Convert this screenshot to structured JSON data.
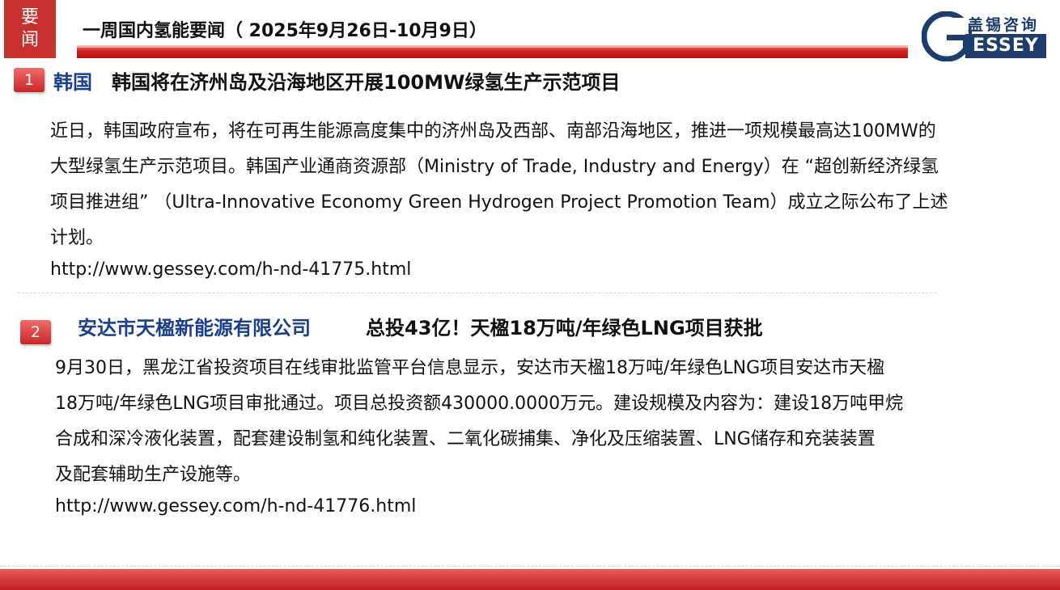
{
  "header": {
    "tag_char_1": "要",
    "tag_char_2": "闻",
    "title": "一周国内氢能要闻（ 2025年9月26日-10月9日）",
    "logo_chinese": "盖锡咨询",
    "logo_latin": "ESSEY",
    "logo_initial": "G"
  },
  "items": [
    {
      "number": "1",
      "org": "韩国",
      "headline": "韩国将在济州岛及沿海地区开展100MW绿氢生产示范项目",
      "lines": [
        "近日，韩国政府宣布，将在可再生能源高度集中的济州岛及西部、南部沿海地区，推进一项规模最高达100MW的",
        "大型绿氢生产示范项目。韩国产业通商资源部（Ministry of Trade, Industry and Energy）在 “超创新经济绿氢",
        "项目推进组” （Ultra-Innovative Economy Green Hydrogen Project Promotion Team）成立之际公布了上述",
        "计划。",
        "http://www.gessey.com/h-nd-41775.html"
      ]
    },
    {
      "number": "2",
      "org": "安达市天楹新能源有限公司",
      "headline": "总投43亿！天楹18万吨/年绿色LNG项目获批",
      "lines": [
        "9月30日，黑龙江省投资项目在线审批监管平台信息显示，安达市天楹18万吨/年绿色LNG项目安达市天楹",
        "18万吨/年绿色LNG项目审批通过。项目总投资额430000.0000万元。建设规模及内容为：建设18万吨甲烷",
        "合成和深冷液化装置，配套建设制氢和纯化装置、二氧化碳捕集、净化及压缩装置、LNG储存和充装装置",
        "及配套辅助生产设施等。",
        "http://www.gessey.com/h-nd-41776.html"
      ]
    }
  ],
  "colors": {
    "accent_red": "#c8312e",
    "org_blue": "#1a3f8c",
    "logo_navy": "#1e3c6c"
  }
}
